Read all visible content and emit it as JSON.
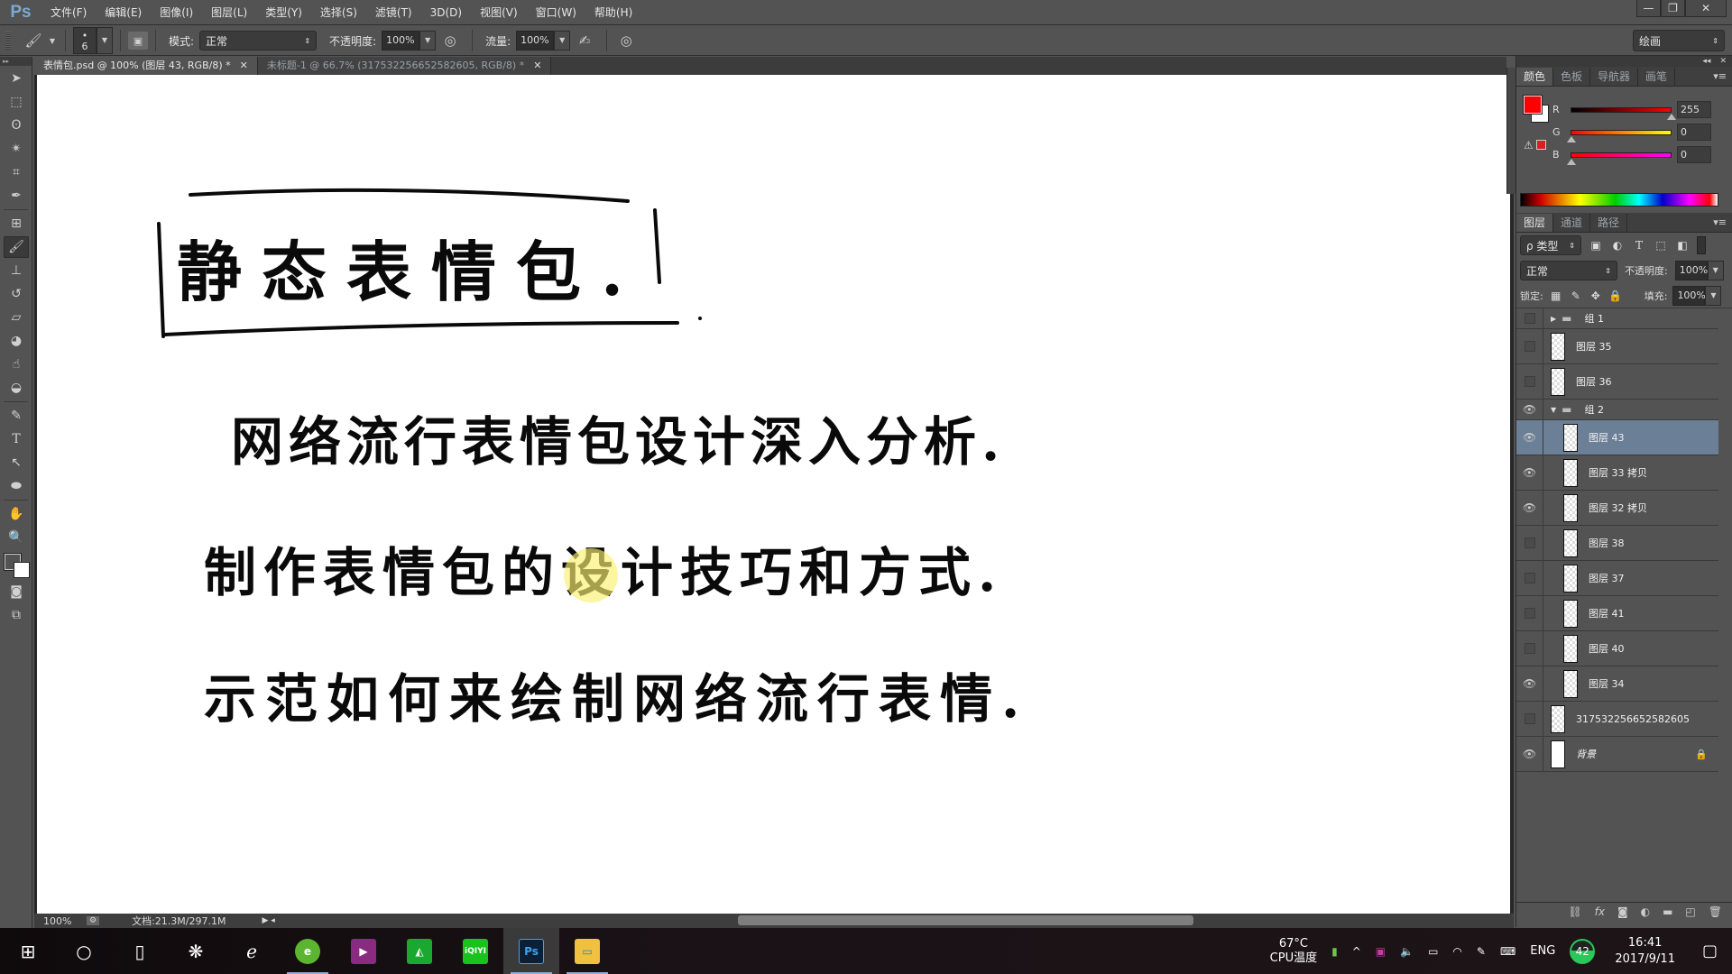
{
  "app": {
    "logo": "Ps"
  },
  "menu": [
    "文件(F)",
    "编辑(E)",
    "图像(I)",
    "图层(L)",
    "类型(Y)",
    "选择(S)",
    "滤镜(T)",
    "3D(D)",
    "视图(V)",
    "窗口(W)",
    "帮助(H)"
  ],
  "window_controls": {
    "minimize": "—",
    "restore": "❐",
    "close": "✕"
  },
  "options": {
    "brush_size": "6",
    "mode_label": "模式:",
    "mode_value": "正常",
    "opacity_label": "不透明度:",
    "opacity_value": "100%",
    "flow_label": "流量:",
    "flow_value": "100%",
    "workspace": "绘画"
  },
  "tabs": [
    {
      "title": "表情包.psd @ 100% (图层 43, RGB/8) *",
      "active": true
    },
    {
      "title": "未标题-1 @ 66.7% (317532256652582605, RGB/8) *",
      "active": false
    }
  ],
  "tools": [
    "move",
    "marquee",
    "lasso",
    "magic-wand",
    "crop",
    "eyedropper",
    "healing",
    "brush",
    "stamp",
    "history-brush",
    "eraser",
    "paint-bucket",
    "smudge",
    "dodge",
    "pen",
    "type",
    "path-select",
    "ellipse",
    "hand",
    "zoom"
  ],
  "colors": {
    "foreground": "#ff0000",
    "background": "#ffffff",
    "accent": "#6b7f96"
  },
  "canvas": {
    "title": "静态表情包.",
    "lines": [
      "网络流行表情包设计深入分析.",
      "制作表情包的设计技巧和方式.",
      "示范如何来绘制网络流行表情."
    ]
  },
  "status": {
    "zoom": "100%",
    "doc": "文档:21.3M/297.1M"
  },
  "color_panel": {
    "tabs": [
      "颜色",
      "色板",
      "导航器",
      "画笔"
    ],
    "r": {
      "label": "R",
      "value": "255"
    },
    "g": {
      "label": "G",
      "value": "0"
    },
    "b": {
      "label": "B",
      "value": "0"
    }
  },
  "layers_panel": {
    "tabs": [
      "图层",
      "通道",
      "路径"
    ],
    "filter": "ρ 类型",
    "blend": "正常",
    "opacity_label": "不透明度:",
    "opacity_value": "100%",
    "lock_label": "锁定:",
    "fill_label": "填充:",
    "fill_value": "100%",
    "layers": [
      {
        "name": "组 1",
        "type": "group",
        "visible": false,
        "expanded": false
      },
      {
        "name": "图层 35",
        "type": "layer",
        "visible": false
      },
      {
        "name": "图层 36",
        "type": "layer",
        "visible": false
      },
      {
        "name": "组 2",
        "type": "group",
        "visible": true,
        "expanded": true
      },
      {
        "name": "图层 43",
        "type": "layer",
        "visible": true,
        "selected": true,
        "indent": true
      },
      {
        "name": "图层 33 拷贝",
        "type": "layer",
        "visible": true,
        "indent": true
      },
      {
        "name": "图层 32 拷贝",
        "type": "layer",
        "visible": true,
        "indent": true
      },
      {
        "name": "图层 38",
        "type": "layer",
        "visible": false,
        "indent": true
      },
      {
        "name": "图层 37",
        "type": "layer",
        "visible": false,
        "indent": true
      },
      {
        "name": "图层 41",
        "type": "layer",
        "visible": false,
        "indent": true
      },
      {
        "name": "图层 40",
        "type": "layer",
        "visible": false,
        "indent": true
      },
      {
        "name": "图层 34",
        "type": "layer",
        "visible": true,
        "indent": true
      },
      {
        "name": "317532256652582605",
        "type": "layer",
        "visible": false
      },
      {
        "name": "背景",
        "type": "background",
        "visible": true,
        "locked": true
      }
    ]
  },
  "taskbar": {
    "apps": [
      "start",
      "search",
      "task-view",
      "app-fan",
      "ie",
      "browser-360",
      "video-recorder",
      "green-app",
      "iqiyi",
      "photoshop",
      "file-explorer"
    ],
    "cpu_temp": "67°C",
    "cpu_label": "CPU温度",
    "lang": "ENG",
    "badge": "42",
    "time": "16:41",
    "date": "2017/9/11"
  }
}
